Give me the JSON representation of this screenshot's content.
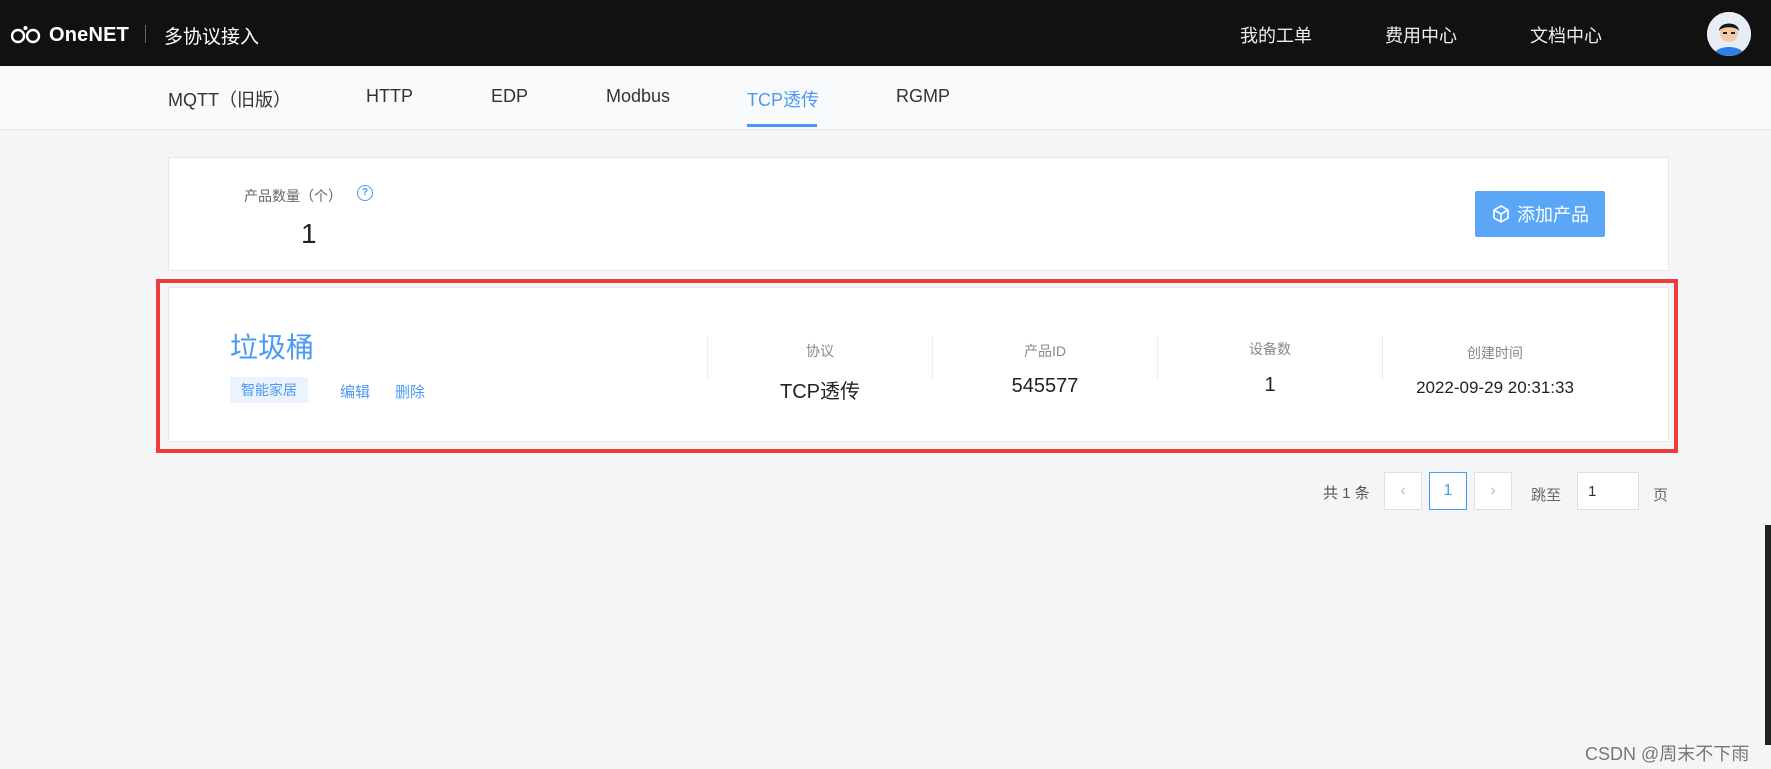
{
  "header": {
    "logo_text": "OneNET",
    "app_title": "多协议接入",
    "nav": [
      "我的工单",
      "费用中心",
      "文档中心"
    ]
  },
  "tabs": [
    "MQTT（旧版）",
    "HTTP",
    "EDP",
    "Modbus",
    "TCP透传",
    "RGMP"
  ],
  "active_tab": "TCP透传",
  "summary": {
    "label": "产品数量（个）",
    "help_icon": "?",
    "count": "1",
    "add_button": "添加产品"
  },
  "product": {
    "name": "垃圾桶",
    "tag": "智能家居",
    "edit": "编辑",
    "delete": "删除",
    "columns": [
      {
        "label": "协议",
        "value": "TCP透传"
      },
      {
        "label": "产品ID",
        "value": "545577"
      },
      {
        "label": "设备数",
        "value": "1"
      },
      {
        "label": "创建时间",
        "value": "2022-09-29 20:31:33"
      }
    ]
  },
  "pagination": {
    "total": "共 1 条",
    "prev": "‹",
    "current": "1",
    "next": "›",
    "jump_label": "跳至",
    "jump_value": "1",
    "page_unit": "页"
  },
  "watermark": "CSDN @周末不下雨",
  "colors": {
    "accent": "#4a9af5",
    "topbar": "#111111",
    "highlight": "#ee3b3b",
    "add_button": "#5ba7f7"
  }
}
